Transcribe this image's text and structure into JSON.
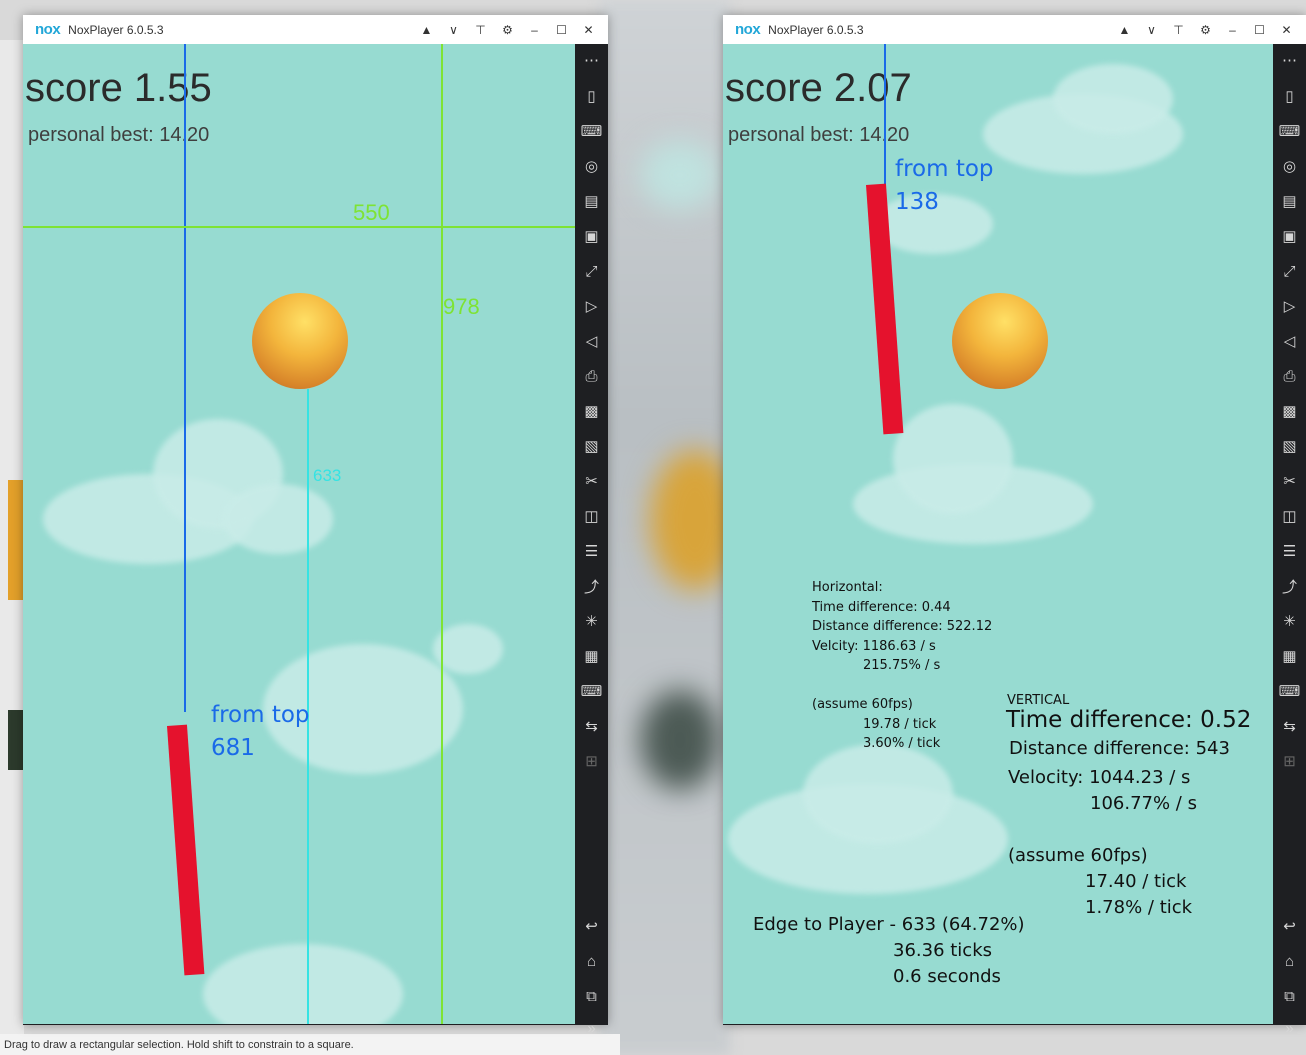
{
  "status_bar": {
    "text": "Drag to draw a rectangular selection. Hold shift to constrain to a square."
  },
  "windows": [
    {
      "title": "NoxPlayer 6.0.5.3",
      "logo": "nox",
      "score": "score 1.55",
      "personal_best": "personal best: 14.20",
      "annotations": {
        "from_top_label": "from top",
        "from_top_value": "681",
        "horizontal_line_label": "550",
        "vertical_line_label": "978",
        "cyan_line_label": "633"
      }
    },
    {
      "title": "NoxPlayer 6.0.5.3",
      "logo": "nox",
      "score": "score 2.07",
      "personal_best": "personal best: 14.20",
      "annotations": {
        "from_top_label": "from top",
        "from_top_value": "138"
      },
      "horizontal_notes": [
        "Horizontal:",
        "Time difference: 0.44",
        "Distance difference: 522.12",
        "Velcity: 1186.63 / s",
        "215.75% / s",
        "(assume 60fps)",
        "19.78 / tick",
        "3.60% / tick"
      ],
      "vertical_notes": {
        "heading": "VERTICAL",
        "time_difference": "Time difference: 0.52",
        "distance_difference": "Distance difference: 543",
        "velocity": "Velocity: 1044.23 / s",
        "velocity_pct": "106.77% / s",
        "fps_note": "(assume 60fps)",
        "per_tick": "17.40  / tick",
        "per_tick_pct": "1.78% / tick"
      },
      "edge_notes": {
        "line1": "Edge to Player - 633 (64.72%)",
        "line2": "36.36 ticks",
        "line3": "0.6 seconds"
      }
    }
  ],
  "title_controls": [
    "gift-icon",
    "chevron-down-icon",
    "pin-icon",
    "settings-icon",
    "minimize-icon",
    "maximize-icon",
    "close-icon"
  ],
  "sidebar_icons": [
    "more-dots-icon",
    "shake-icon",
    "keyboard-icon",
    "location-icon",
    "screen-icon",
    "recorder-icon",
    "fullscreen-icon",
    "volume-up-icon",
    "volume-down-icon",
    "print-icon",
    "macro-icon",
    "apk-icon",
    "scissors-icon",
    "multi-instance-icon",
    "menu-icon",
    "link-icon",
    "loading-icon",
    "camera-icon",
    "gamepad-icon",
    "sync-icon",
    "add-icon",
    "back-icon",
    "home-icon",
    "recent-apps-icon",
    "expand-icon"
  ],
  "colors": {
    "game_bg": "#97dbd1",
    "bar": "#e5122d",
    "blue_annotation": "#1a6ae8",
    "green_annotation": "#7ee334",
    "cyan_annotation": "#35e3e3",
    "nox_brand": "#22a7d8"
  }
}
